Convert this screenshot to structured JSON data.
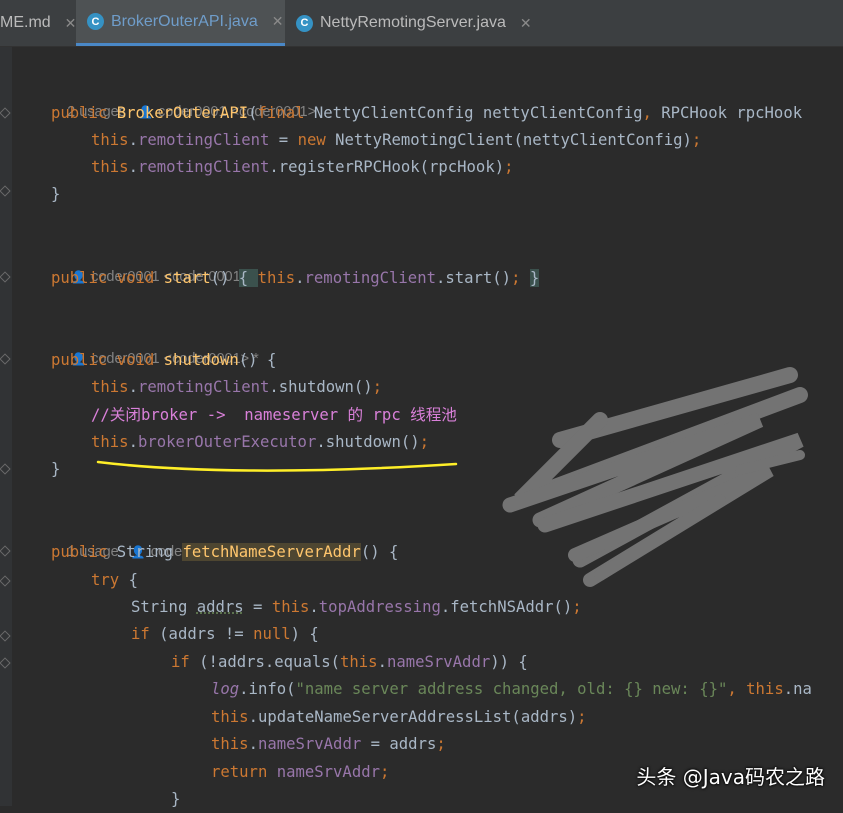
{
  "tabs": [
    {
      "title": "ME.md",
      "close": "✕",
      "icon": ""
    },
    {
      "title": "BrokerOuterAPI.java",
      "close": "✕",
      "icon": "C",
      "active": true
    },
    {
      "title": "NettyRemotingServer.java",
      "close": "✕",
      "icon": "C"
    }
  ],
  "hints": {
    "h1": {
      "usages": "2 usages",
      "author": "coder0001 <coder0001>"
    },
    "h2": {
      "author": "coder0001 <coder0001>"
    },
    "h3": {
      "author": "coder0001 <coder0001> *"
    },
    "h4": {
      "usages": "1 usage",
      "author": "coder0001 <coder0001>"
    }
  },
  "code": {
    "l1": {
      "a": "public ",
      "b": "BrokerOuterAPI",
      "c": "(",
      "d": "final ",
      "e": "NettyClientConfig nettyClientConfig",
      "f": ", ",
      "g": "RPCHook rpcHook"
    },
    "l2": {
      "a": "this",
      "b": ".",
      "c": "remotingClient",
      "d": " = ",
      "e": "new ",
      "f": "NettyRemotingClient(nettyClientConfig)",
      "g": ";"
    },
    "l3": {
      "a": "this",
      "b": ".",
      "c": "remotingClient",
      "d": ".registerRPCHook(rpcHook)",
      "e": ";"
    },
    "l4": {
      "a": "}"
    },
    "l5": {
      "a": "public void ",
      "b": "start",
      "c": "() ",
      "d": "{ ",
      "e": "this",
      "f": ".",
      "g": "remotingClient",
      "h": ".start()",
      "i": "; ",
      "j": "}"
    },
    "l6": {
      "a": "public void ",
      "b": "shutdown",
      "c": "() {"
    },
    "l7": {
      "a": "this",
      "b": ".",
      "c": "remotingClient",
      "d": ".shutdown()",
      "e": ";"
    },
    "l8": {
      "a": "//",
      "b": "关闭",
      "c": "broker -> ",
      "d": " nameserver ",
      "e": "的",
      "f": " rpc ",
      "g": "线程池"
    },
    "l9": {
      "a": "this",
      "b": ".",
      "c": "brokerOuterExecutor",
      "d": ".shutdown()",
      "e": ";"
    },
    "l10": {
      "a": "}"
    },
    "l11": {
      "a": "public ",
      "b": "String ",
      "c": "fetchNameServerAddr",
      "d": "() {"
    },
    "l12": {
      "a": "try ",
      "b": "{"
    },
    "l13": {
      "a": "String ",
      "b": "addrs",
      "c": " = ",
      "d": "this",
      "e": ".",
      "f": "topAddressing",
      "g": ".fetchNSAddr()",
      "h": ";"
    },
    "l14": {
      "a": "if ",
      "b": "(addrs != ",
      "c": "null",
      "d": ") {"
    },
    "l15": {
      "a": "if ",
      "b": "(!addrs.equals(",
      "c": "this",
      "d": ".",
      "e": "nameSrvAddr",
      "f": ")) {"
    },
    "l16": {
      "a": "log",
      "b": ".info(",
      "c": "\"name server address changed, old: {} new: {}\"",
      "d": ", ",
      "e": "this",
      "f": ".na"
    },
    "l17": {
      "a": "this",
      "b": ".updateNameServerAddressList(addrs)",
      "c": ";"
    },
    "l18": {
      "a": "this",
      "b": ".",
      "c": "nameSrvAddr",
      "d": " = addrs",
      "e": ";"
    },
    "l19": {
      "a": "return ",
      "b": "nameSrvAddr",
      "c": ";"
    },
    "l20": {
      "a": "}"
    }
  },
  "watermark": "头条 @Java码农之路",
  "colors": {
    "background": "#2b2b2b",
    "keyword": "#cc7832",
    "method": "#ffc66d",
    "field": "#9876aa",
    "string": "#6a8759",
    "underline": "#ffef28",
    "scribble": "#7a7a7a"
  }
}
